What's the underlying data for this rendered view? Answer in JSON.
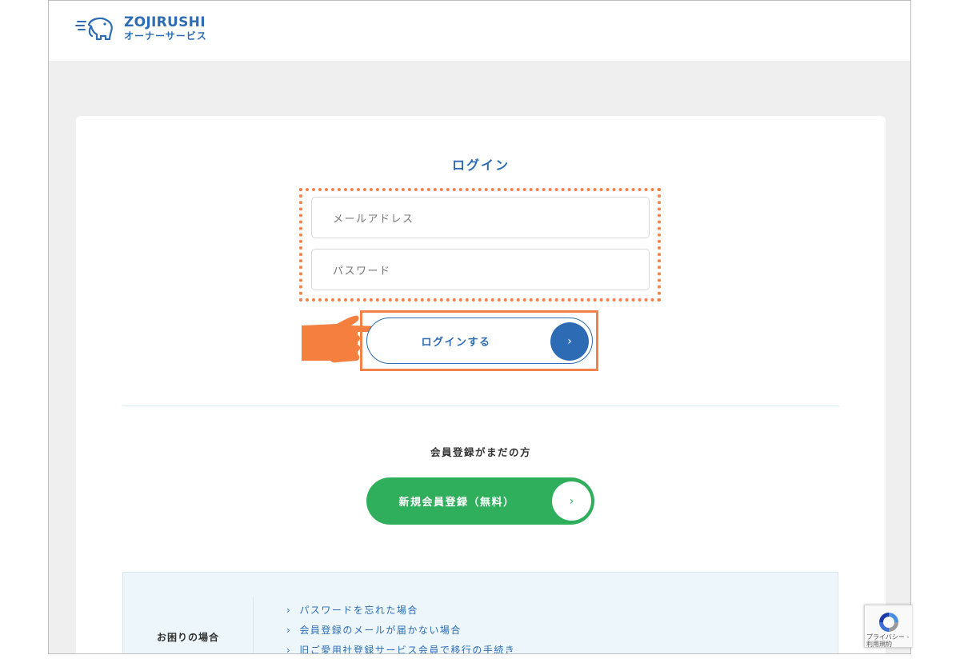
{
  "header": {
    "brand": "ZOJIRUSHI",
    "brand_sub": "オーナーサービス"
  },
  "login": {
    "title": "ログイン",
    "email_placeholder": "メールアドレス",
    "password_placeholder": "パスワード",
    "submit_label": "ログインする",
    "submit_arrow": "›"
  },
  "register": {
    "heading": "会員登録がまだの方",
    "button_label": "新規会員登録（無料）",
    "button_arrow": "›"
  },
  "help": {
    "label": "お困りの場合",
    "links": [
      "パスワードを忘れた場合",
      "会員登録のメールが届かない場合",
      "旧ご愛用社登録サービス会員で移行の手続き"
    ]
  },
  "recaptcha": {
    "privacy": "プライバシー",
    "terms": "利用規約"
  },
  "colors": {
    "brand_blue": "#2d6cb5",
    "register_green": "#2fae5c",
    "highlight_orange": "#f0824a",
    "background_gray": "#efefef"
  },
  "icons": [
    "elephant-logo-icon",
    "pointing-hand-icon",
    "chevron-right-icon",
    "recaptcha-icon"
  ]
}
